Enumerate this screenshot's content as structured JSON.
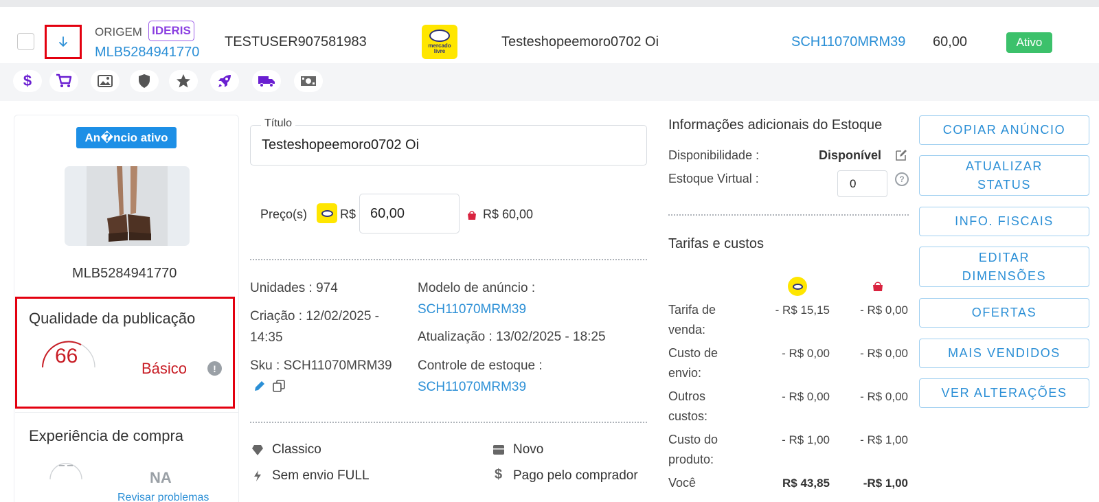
{
  "header": {
    "origin_label": "ORIGEM",
    "origin_badge": "IDERIS",
    "listing_id": "MLB5284941770",
    "user": "TESTUSER907581983",
    "marketplace_logo": "mercado-livre-logo",
    "marketplace_logo_text": "mercado livre",
    "title": "Testeshopeemoro0702 Oi",
    "sku": "SCH11070MRM39",
    "price": "60,00",
    "status": "Ativo"
  },
  "toolbar": {
    "icons": [
      "dollar-icon",
      "cart-icon",
      "image-icon",
      "shield-icon",
      "star-icon",
      "rocket-icon",
      "truck-icon",
      "money-icon"
    ]
  },
  "left": {
    "ad_status": "An�ncio ativo",
    "thumb_id": "MLB5284941770",
    "quality": {
      "title": "Qualidade da publicação",
      "score": "66",
      "level": "Básico",
      "info_glyph": "!"
    },
    "buy_experience": {
      "title": "Experiência de compra",
      "value": "NA",
      "link": "Revisar problemas"
    }
  },
  "center": {
    "title_label": "Título",
    "title_value": "Testeshopeemoro0702 Oi",
    "price_label": "Preço(s)",
    "price_currency": "R$",
    "price_value": "60,00",
    "shopee_price": "R$ 60,00",
    "units": "Unidades : 974",
    "created": "Criação : 12/02/2025 - 14:35",
    "sku": "Sku : SCH11070MRM39",
    "model_label": "Modelo de anúncio :",
    "model_value": "SCH11070MRM39",
    "updated": "Atualização : 13/02/2025 - 18:25",
    "stock_control_label": "Controle de estoque :",
    "stock_control_value": "SCH11070MRM39",
    "features": [
      {
        "icon": "diamond-icon",
        "text": "Classico"
      },
      {
        "icon": "box-icon",
        "text": "Novo"
      },
      {
        "icon": "bolt-icon",
        "text": "Sem envio FULL"
      },
      {
        "icon": "dollar-icon",
        "text": "Pago pelo comprador"
      }
    ]
  },
  "stock": {
    "title": "Informações adicionais do Estoque",
    "availability_label": "Disponibilidade :",
    "availability_value": "Disponível",
    "virtual_label": "Estoque Virtual :",
    "virtual_value": "0",
    "help_glyph": "?"
  },
  "fees": {
    "title": "Tarifas e custos",
    "rows": [
      {
        "label": "Tarifa de venda:",
        "ml": "- R$ 15,15",
        "shopee": "- R$ 0,00"
      },
      {
        "label": "Custo de envio:",
        "ml": "- R$ 0,00",
        "shopee": "- R$ 0,00"
      },
      {
        "label": "Outros custos:",
        "ml": "- R$ 0,00",
        "shopee": "- R$ 0,00"
      },
      {
        "label": "Custo do produto:",
        "ml": "- R$ 1,00",
        "shopee": "- R$ 1,00"
      },
      {
        "label": "Você",
        "ml": "R$ 43,85",
        "shopee": "-R$ 1,00"
      }
    ]
  },
  "actions": [
    "COPIAR ANÚNCIO",
    "ATUALIZAR STATUS",
    "INFO. FISCAIS",
    "EDITAR DIMENSÕES",
    "OFERTAS",
    "MAIS VENDIDOS",
    "VER ALTERAÇÕES"
  ],
  "colors": {
    "accent_blue": "#2b8fd6",
    "ml_yellow": "#ffe600",
    "ml_navy": "#2d3277",
    "status_green": "#3cc16b",
    "highlight_red": "#e3000f",
    "quality_red": "#c81d25",
    "ideris_purple": "#8a3fe0",
    "toolbar_icon_purple": "#6a1fd1"
  }
}
